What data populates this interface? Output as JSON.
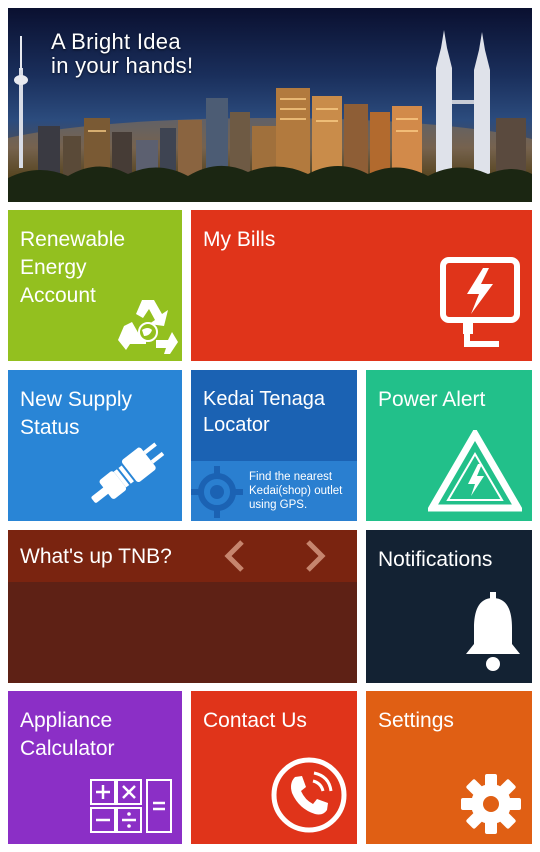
{
  "banner": {
    "tagline_line1": "A Bright Idea",
    "tagline_line2": "in your hands!"
  },
  "tiles": {
    "renewable": {
      "label": "Renewable\nEnergy\nAccount",
      "color": "#93c01f",
      "icon": "recycle-globe-icon"
    },
    "bills": {
      "label": "My Bills",
      "color": "#e0341a",
      "icon": "bill-lightning-icon"
    },
    "new_supply": {
      "label": "New Supply\nStatus",
      "color": "#2985d6",
      "icon": "power-plug-icon"
    },
    "kedai": {
      "label": "Kedai Tenaga\nLocator",
      "description": "Find the nearest\nKedai(shop) outlet\nusing GPS.",
      "color": "#1b62b3",
      "icon": "crosshair-locator-icon"
    },
    "power_alert": {
      "label": "Power Alert",
      "color": "#22c08a",
      "icon": "warning-triangle-icon"
    },
    "whats_up": {
      "label": "What's up TNB?",
      "color": "#7a2410",
      "icons": [
        "chevron-left-icon",
        "chevron-right-icon"
      ]
    },
    "notifications": {
      "label": "Notifications",
      "color": "#132233",
      "icon": "bell-icon"
    },
    "appliance": {
      "label": "Appliance\nCalculator",
      "color": "#8b2fc6",
      "icon": "calculator-icon"
    },
    "contact": {
      "label": "Contact Us",
      "color": "#e0341a",
      "icon": "phone-icon"
    },
    "settings": {
      "label": "Settings",
      "color": "#e05f14",
      "icon": "gear-icon"
    }
  }
}
